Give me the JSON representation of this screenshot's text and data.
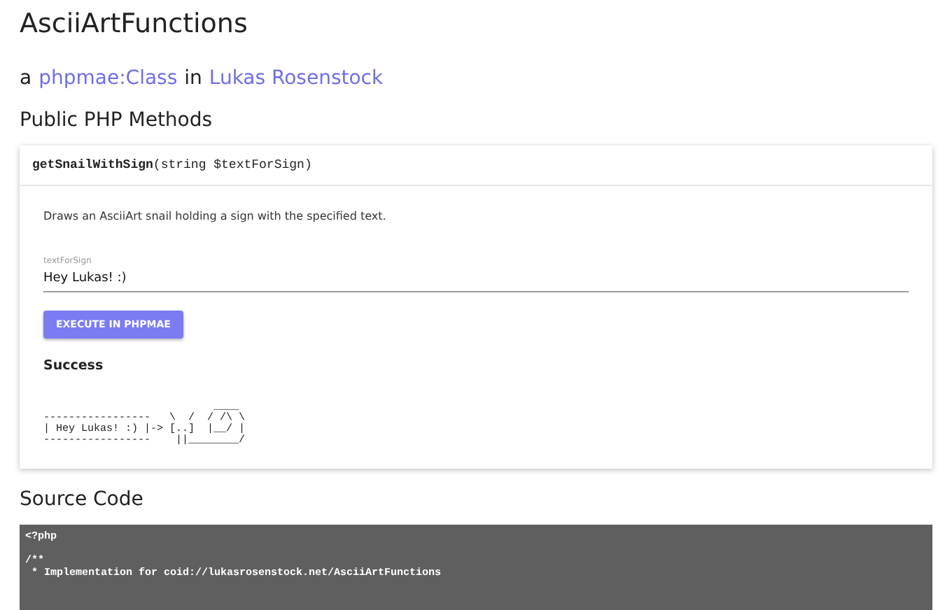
{
  "title": "AsciiArtFunctions",
  "subtitle": {
    "prefix": "a",
    "type_link": "phpmae:Class",
    "middle": "in",
    "owner_link": "Lukas Rosenstock"
  },
  "methods_heading": "Public PHP Methods",
  "method": {
    "name": "getSnailWithSign",
    "signature": "(string $textForSign)",
    "description": "Draws an AsciiArt snail holding a sign with the specified text.",
    "field": {
      "label": "textForSign",
      "value": "Hey Lukas! :)"
    },
    "button": "EXECUTE IN PHPMAE",
    "result_status": "Success",
    "result_output": "                           ____\n-----------------   \\  /  / /\\ \\\n| Hey Lukas! :) |-> [..]  |__/ |\n-----------------    ||________/"
  },
  "source_heading": "Source Code",
  "source_blocks": [
    [
      "<?php"
    ],
    [
      "/**",
      " * Implementation for coid://lukasrosenstock.net/AsciiArtFunctions"
    ]
  ]
}
